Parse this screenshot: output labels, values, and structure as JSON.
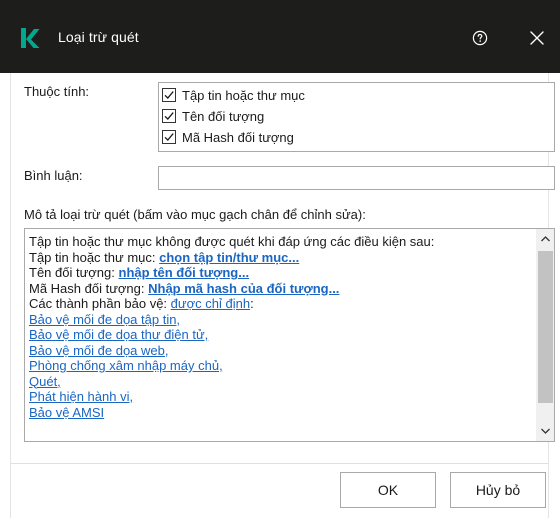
{
  "window": {
    "title": "Loại trừ quét",
    "logo_icon": "kaspersky-k-logo",
    "help_icon": "help-circle-icon",
    "close_icon": "close-icon",
    "colors": {
      "titlebar": "#1d1d1b",
      "logo": "#00a88e",
      "link": "#1a66c2"
    }
  },
  "properties": {
    "label": "Thuộc tính:",
    "items": [
      {
        "label": "Tập tin hoặc thư mục",
        "checked": true
      },
      {
        "label": "Tên đối tượng",
        "checked": true
      },
      {
        "label": "Mã Hash đối tượng",
        "checked": true
      }
    ]
  },
  "comment": {
    "label": "Bình luận:",
    "value": "",
    "placeholder": ""
  },
  "description": {
    "label": "Mô tả loại trừ quét (bấm vào mục gạch chân để chỉnh sửa):",
    "intro": "Tập tin hoặc thư mục không được quét khi đáp ứng các điều kiện sau:",
    "file_prefix": "Tập tin hoặc thư mục: ",
    "file_link": "chọn tập tin/thư mục...",
    "name_prefix": "Tên đối tượng: ",
    "name_link": "nhập tên đối tượng...",
    "hash_prefix": "Mã Hash đối tượng: ",
    "hash_link": "Nhập mã hash của đối tượng...",
    "components_prefix": "Các thành phần bảo vệ: ",
    "components_link": "được chỉ định",
    "components_suffix": ":",
    "components": [
      "Bảo vệ mối đe dọa tập tin,",
      "Bảo vệ mối đe dọa thư điện tử,",
      "Bảo vệ mối đe dọa web,",
      "Phòng chống xâm nhập máy chủ,",
      "Quét,",
      "Phát hiện hành vi,",
      "Bảo vệ AMSI"
    ]
  },
  "buttons": {
    "ok": "OK",
    "cancel": "Hủy bỏ"
  }
}
